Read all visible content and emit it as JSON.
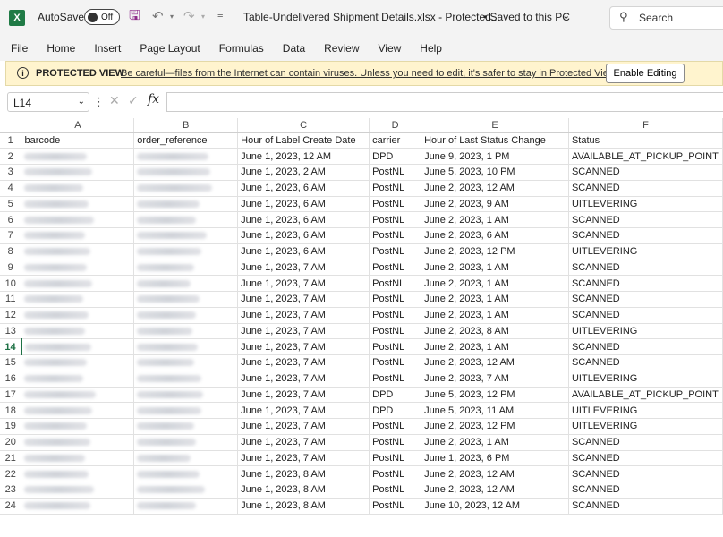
{
  "titlebar": {
    "app_icon": "X",
    "autosave_label": "AutoSave",
    "autosave_state": "Off",
    "doc_title": "Table-Undelivered Shipment Details.xlsx  -  Protected...",
    "save_status": "•  Saved to this PC",
    "search_placeholder": "Search"
  },
  "ribbon": {
    "tabs": [
      "File",
      "Home",
      "Insert",
      "Page Layout",
      "Formulas",
      "Data",
      "Review",
      "View",
      "Help"
    ]
  },
  "protected_view": {
    "title": "PROTECTED VIEW",
    "message": "Be careful—files from the Internet can contain viruses. Unless you need to edit, it's safer to stay in Protected View.",
    "button": "Enable Editing"
  },
  "formula_bar": {
    "name_box": "L14",
    "formula": ""
  },
  "sheet": {
    "active_row": 14,
    "columns": [
      "A",
      "B",
      "C",
      "D",
      "E",
      "F"
    ],
    "headers": [
      "barcode",
      "order_reference",
      "Hour of Label Create Date",
      "carrier",
      "Hour of Last Status Change",
      "Status"
    ],
    "rows": [
      {
        "c": "June 1, 2023, 12 AM",
        "d": "DPD",
        "e": "June 9, 2023, 1 PM",
        "f": "AVAILABLE_AT_PICKUP_POINT"
      },
      {
        "c": "June 1, 2023, 2 AM",
        "d": "PostNL",
        "e": "June 5, 2023, 10 PM",
        "f": "SCANNED"
      },
      {
        "c": "June 1, 2023, 6 AM",
        "d": "PostNL",
        "e": "June 2, 2023, 12 AM",
        "f": "SCANNED"
      },
      {
        "c": "June 1, 2023, 6 AM",
        "d": "PostNL",
        "e": "June 2, 2023, 9 AM",
        "f": "UITLEVERING"
      },
      {
        "c": "June 1, 2023, 6 AM",
        "d": "PostNL",
        "e": "June 2, 2023, 1 AM",
        "f": "SCANNED"
      },
      {
        "c": "June 1, 2023, 6 AM",
        "d": "PostNL",
        "e": "June 2, 2023, 6 AM",
        "f": "SCANNED"
      },
      {
        "c": "June 1, 2023, 6 AM",
        "d": "PostNL",
        "e": "June 2, 2023, 12 PM",
        "f": "UITLEVERING"
      },
      {
        "c": "June 1, 2023, 7 AM",
        "d": "PostNL",
        "e": "June 2, 2023, 1 AM",
        "f": "SCANNED"
      },
      {
        "c": "June 1, 2023, 7 AM",
        "d": "PostNL",
        "e": "June 2, 2023, 1 AM",
        "f": "SCANNED"
      },
      {
        "c": "June 1, 2023, 7 AM",
        "d": "PostNL",
        "e": "June 2, 2023, 1 AM",
        "f": "SCANNED"
      },
      {
        "c": "June 1, 2023, 7 AM",
        "d": "PostNL",
        "e": "June 2, 2023, 1 AM",
        "f": "SCANNED"
      },
      {
        "c": "June 1, 2023, 7 AM",
        "d": "PostNL",
        "e": "June 2, 2023, 8 AM",
        "f": "UITLEVERING"
      },
      {
        "c": "June 1, 2023, 7 AM",
        "d": "PostNL",
        "e": "June 2, 2023, 1 AM",
        "f": "SCANNED"
      },
      {
        "c": "June 1, 2023, 7 AM",
        "d": "PostNL",
        "e": "June 2, 2023, 12 AM",
        "f": "SCANNED"
      },
      {
        "c": "June 1, 2023, 7 AM",
        "d": "PostNL",
        "e": "June 2, 2023, 7 AM",
        "f": "UITLEVERING"
      },
      {
        "c": "June 1, 2023, 7 AM",
        "d": "DPD",
        "e": "June 5, 2023, 12 PM",
        "f": "AVAILABLE_AT_PICKUP_POINT"
      },
      {
        "c": "June 1, 2023, 7 AM",
        "d": "DPD",
        "e": "June 5, 2023, 11 AM",
        "f": "UITLEVERING"
      },
      {
        "c": "June 1, 2023, 7 AM",
        "d": "PostNL",
        "e": "June 2, 2023, 12 PM",
        "f": "UITLEVERING"
      },
      {
        "c": "June 1, 2023, 7 AM",
        "d": "PostNL",
        "e": "June 2, 2023, 1 AM",
        "f": "SCANNED"
      },
      {
        "c": "June 1, 2023, 7 AM",
        "d": "PostNL",
        "e": "June 1, 2023, 6 PM",
        "f": "SCANNED"
      },
      {
        "c": "June 1, 2023, 8 AM",
        "d": "PostNL",
        "e": "June 2, 2023, 12 AM",
        "f": "SCANNED"
      },
      {
        "c": "June 1, 2023, 8 AM",
        "d": "PostNL",
        "e": "June 2, 2023, 12 AM",
        "f": "SCANNED"
      },
      {
        "c": "June 1, 2023, 8 AM",
        "d": "PostNL",
        "e": "June 10, 2023, 12 AM",
        "f": "SCANNED"
      }
    ]
  },
  "colors": {
    "excel_green": "#1f7a45",
    "protected_bg": "#fff4ce",
    "save_icon": "#8e2a8a"
  }
}
